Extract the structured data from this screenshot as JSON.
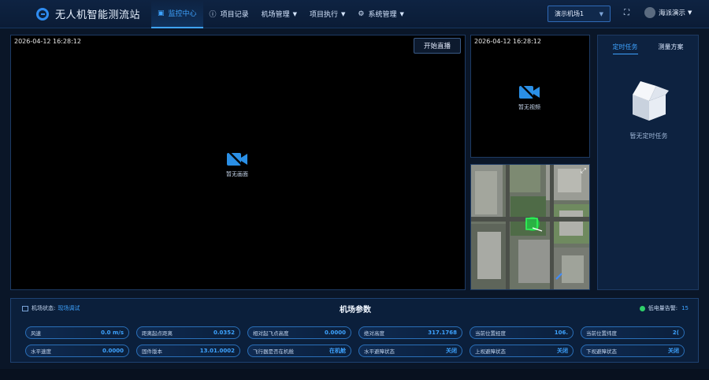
{
  "app": {
    "title": "无人机智能测流站"
  },
  "nav": [
    {
      "label": "监控中心",
      "icon": "camera-icon",
      "active": true,
      "dropdown": false
    },
    {
      "label": "项目记录",
      "icon": "info-icon",
      "active": false,
      "dropdown": false
    },
    {
      "label": "机场管理",
      "icon": "",
      "active": false,
      "dropdown": true
    },
    {
      "label": "项目执行",
      "icon": "",
      "active": false,
      "dropdown": true
    },
    {
      "label": "系统管理",
      "icon": "gear-icon",
      "active": false,
      "dropdown": true
    }
  ],
  "site_select": {
    "value": "演示机场1"
  },
  "user": {
    "name": "海派演示"
  },
  "main_video": {
    "timestamp": "2026-04-12 16:28:12",
    "live_button": "开始直播",
    "empty_text": "暂无画面"
  },
  "side_video": {
    "timestamp": "2026-04-12 16:28:12",
    "empty_text": "暂无视频"
  },
  "tasks": {
    "tabs": [
      "定时任务",
      "测量方案"
    ],
    "active_tab": 0,
    "empty_text": "暂无定时任务"
  },
  "params": {
    "title": "机场参数",
    "status_label": "机场状态:",
    "status_value": "现场调试",
    "battery_label": "低电量告警:",
    "battery_value": "15",
    "row1": [
      {
        "label": "风速",
        "value": "0.0 m/s"
      },
      {
        "label": "距离起点距离",
        "value": "0.0352"
      },
      {
        "label": "相对起飞点高度",
        "value": "0.0000"
      },
      {
        "label": "绝对高度",
        "value": "317.1768"
      },
      {
        "label": "当前位置经度",
        "value": "106."
      },
      {
        "label": "当前位置纬度",
        "value": "2("
      }
    ],
    "row2": [
      {
        "label": "水平速度",
        "value": "0.0000"
      },
      {
        "label": "固件版本",
        "value": "13.01.0002"
      },
      {
        "label": "飞行器是否在机舱",
        "value": "在机舱"
      },
      {
        "label": "水平避障状态",
        "value": "关闭"
      },
      {
        "label": "上视避障状态",
        "value": "关闭"
      },
      {
        "label": "下视避障状态",
        "value": "关闭"
      }
    ]
  },
  "colors": {
    "accent": "#3ea3ff",
    "background": "#0a1628",
    "ok": "#2fcf6a"
  }
}
